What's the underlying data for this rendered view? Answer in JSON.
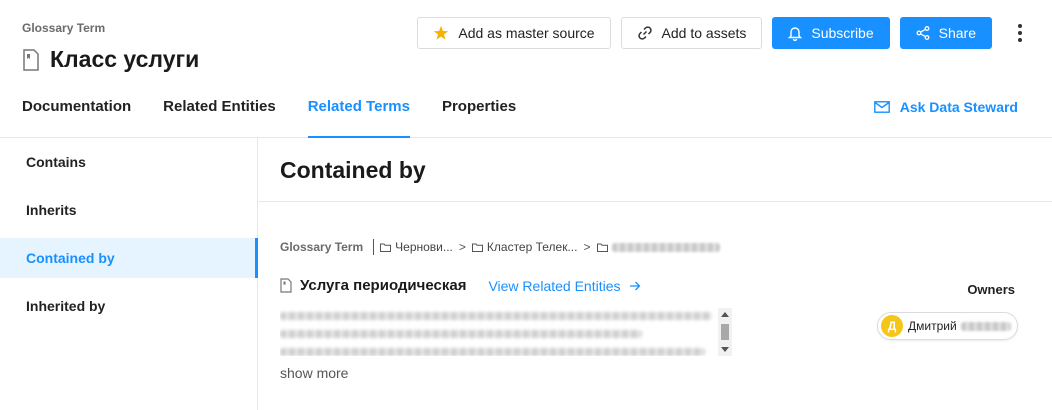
{
  "header": {
    "entity_type": "Glossary Term",
    "title": "Класс услуги",
    "actions": {
      "master_source": "Add as master source",
      "add_assets": "Add to assets",
      "subscribe": "Subscribe",
      "share": "Share"
    }
  },
  "tabs": [
    {
      "label": "Documentation",
      "active": false
    },
    {
      "label": "Related Entities",
      "active": false
    },
    {
      "label": "Related Terms",
      "active": true
    },
    {
      "label": "Properties",
      "active": false
    }
  ],
  "ask_steward": "Ask Data Steward",
  "sidebar": {
    "items": [
      {
        "label": "Contains",
        "active": false
      },
      {
        "label": "Inherits",
        "active": false
      },
      {
        "label": "Contained by",
        "active": true
      },
      {
        "label": "Inherited by",
        "active": false
      }
    ]
  },
  "section": {
    "title": "Contained by"
  },
  "related_term": {
    "breadcrumb": {
      "type": "Glossary Term",
      "items": [
        "Чернови...",
        "Кластер Телек..."
      ]
    },
    "name": "Услуга периодическая",
    "view_related": "View Related Entities",
    "show_more": "show more",
    "owners_label": "Owners",
    "owner": {
      "initial": "Д",
      "name": "Дмитрий"
    }
  },
  "colors": {
    "accent": "#1890ff",
    "avatar": "#f5c518",
    "star": "#f5b301"
  }
}
